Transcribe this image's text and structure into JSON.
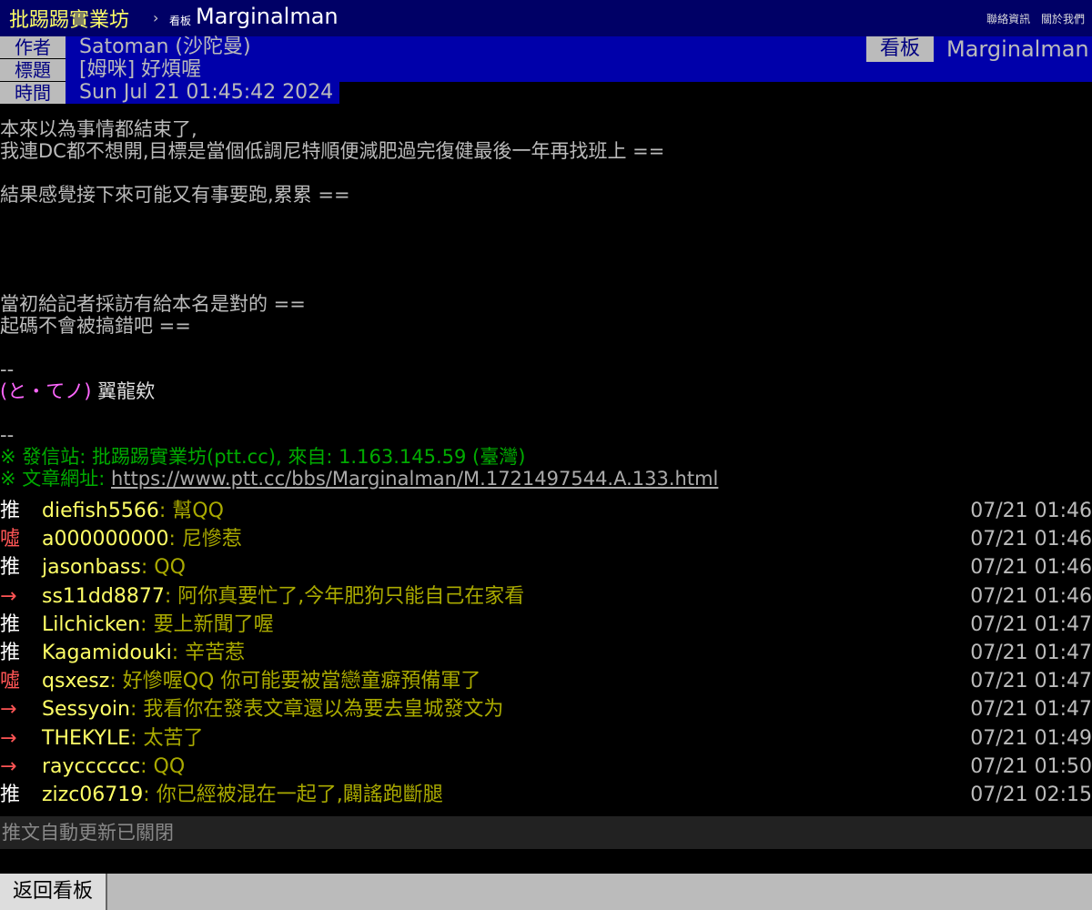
{
  "topbar": {
    "site_name": "批踢踢實業坊",
    "separator": "›",
    "board_label": "看板",
    "board_name": "Marginalman",
    "links": [
      "聯絡資訊",
      "關於我們"
    ]
  },
  "meta": {
    "author_label": "作者",
    "author": "Satoman (沙陀曼)",
    "title_label": "標題",
    "title": "[姆咪] 好煩喔",
    "time_label": "時間",
    "time": "Sun Jul 21 01:45:42 2024",
    "board_label": "看板",
    "board": "Marginalman"
  },
  "body": {
    "lines_a": "本來以為事情都結束了,\n我連DC都不想開,目標是當個低調尼特順便減肥過完復健最後一年再找班上 ==\n\n結果感覺接下來可能又有事要跑,累累 ==",
    "lines_b": "當初給記者採訪有給本名是對的 ==\n起碼不會被搞錯吧 ==",
    "sig_sep": "--",
    "sig_emote": "(と・てノ)",
    "sig_name": "翼龍欸",
    "footer_sep": "--",
    "from_line": "※ 發信站: 批踢踢實業坊(ptt.cc), 來自: 1.163.145.59 (臺灣)",
    "url_label": "※ 文章網址: ",
    "url": "https://www.ptt.cc/bbs/Marginalman/M.1721497544.A.133.html"
  },
  "pushes": [
    {
      "tag": "推",
      "type": "push",
      "user": "diefish5566",
      "content": ": 幫QQ",
      "time": "07/21 01:46"
    },
    {
      "tag": "噓",
      "type": "boo",
      "user": "a000000000",
      "content": ": 尼慘惹",
      "time": "07/21 01:46"
    },
    {
      "tag": "推",
      "type": "push",
      "user": "jasonbass",
      "content": ": QQ",
      "time": "07/21 01:46"
    },
    {
      "tag": "→",
      "type": "arrow",
      "user": "ss11dd8877",
      "content": ": 阿你真要忙了,今年肥狗只能自己在家看",
      "time": "07/21 01:46"
    },
    {
      "tag": "推",
      "type": "push",
      "user": "Lilchicken",
      "content": ": 要上新聞了喔",
      "time": "07/21 01:47"
    },
    {
      "tag": "推",
      "type": "push",
      "user": "Kagamidouki",
      "content": ": 辛苦惹",
      "time": "07/21 01:47"
    },
    {
      "tag": "噓",
      "type": "boo",
      "user": "qsxesz",
      "content": ": 好慘喔QQ 你可能要被當戀童癖預備軍了",
      "time": "07/21 01:47"
    },
    {
      "tag": "→",
      "type": "arrow",
      "user": "Sessyoin",
      "content": ": 我看你在發表文章還以為要去皇城發文为",
      "time": "07/21 01:47"
    },
    {
      "tag": "→",
      "type": "arrow",
      "user": "THEKYLE",
      "content": ": 太苦了",
      "time": "07/21 01:49"
    },
    {
      "tag": "→",
      "type": "arrow",
      "user": "raycccccc",
      "content": ": QQ",
      "time": "07/21 01:50"
    },
    {
      "tag": "推",
      "type": "push",
      "user": "zizc06719",
      "content": ": 你已經被混在一起了,闢謠跑斷腿",
      "time": "07/21 02:15"
    }
  ],
  "autoupdate_text": "推文自動更新已關閉",
  "back_button": "返回看板",
  "colors": {
    "header_bg": "#000066",
    "meta_bg": "#0000aa",
    "push_user": "#ffff66",
    "push_content": "#aaaa00",
    "boo": "#ff5555",
    "signature": "#00aa00"
  }
}
